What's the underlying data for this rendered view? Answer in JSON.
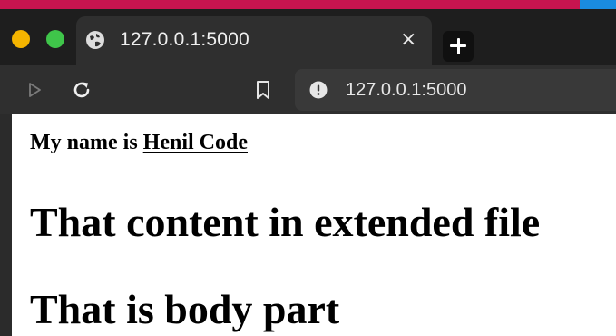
{
  "colors": {
    "top_strip": "#c8144f",
    "top_strip_right": "#1a8ce0",
    "traffic_yellow": "#f4b400",
    "traffic_green": "#3fc54a"
  },
  "tab": {
    "icon": "globe-icon",
    "title": "127.0.0.1:5000",
    "close_glyph": "×"
  },
  "toolbar": {
    "icons": [
      "play-icon",
      "reload-icon",
      "bookmark-icon"
    ],
    "address": {
      "icon": "info-icon",
      "url": "127.0.0.1:5000"
    }
  },
  "page": {
    "name_prefix": "My name is ",
    "name": "Henil Code",
    "heading_1": "That content in extended file",
    "heading_2": "That is body part"
  }
}
